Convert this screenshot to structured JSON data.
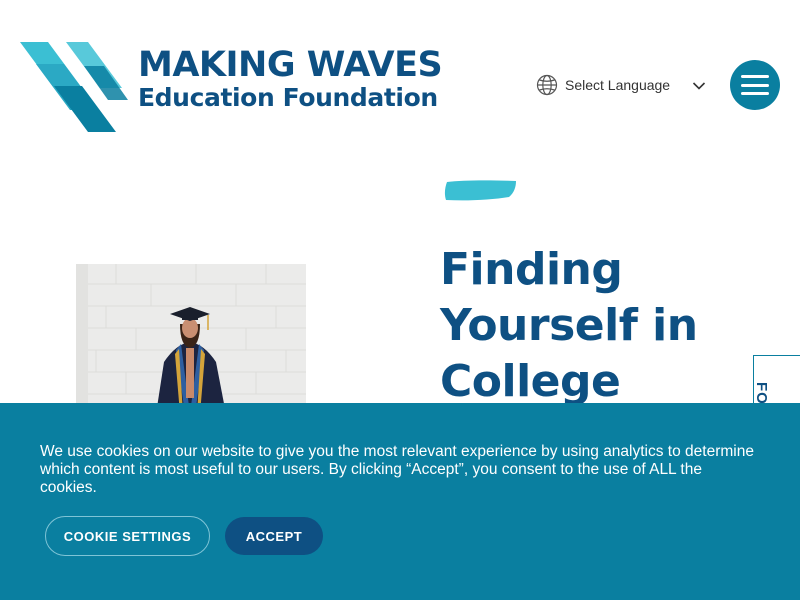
{
  "header": {
    "logo": {
      "title": "MAKING WAVES",
      "subtitle": "Education Foundation",
      "icon": "wave-logo-mark"
    },
    "language": {
      "label": "Select Language",
      "icon": "globe-icon",
      "dropdown_icon": "chevron-down-icon"
    },
    "menu": {
      "icon": "hamburger-menu-icon"
    }
  },
  "hero": {
    "title": "Finding Yourself in College",
    "image": "graduate-photo",
    "decoration": "brush-stroke"
  },
  "feedback_tab": {
    "label": "FO"
  },
  "cookie_banner": {
    "message": "We use cookies on our website to give you the most relevant experience by using analytics to determine which content is most useful to our users. By clicking “Accept”, you consent to the use of ALL the cookies.",
    "settings_label": "COOKIE SETTINGS",
    "accept_label": "ACCEPT"
  },
  "colors": {
    "brand_navy": "#0e5083",
    "brand_teal": "#0a7fa0",
    "brand_aqua": "#3bbfd3"
  }
}
